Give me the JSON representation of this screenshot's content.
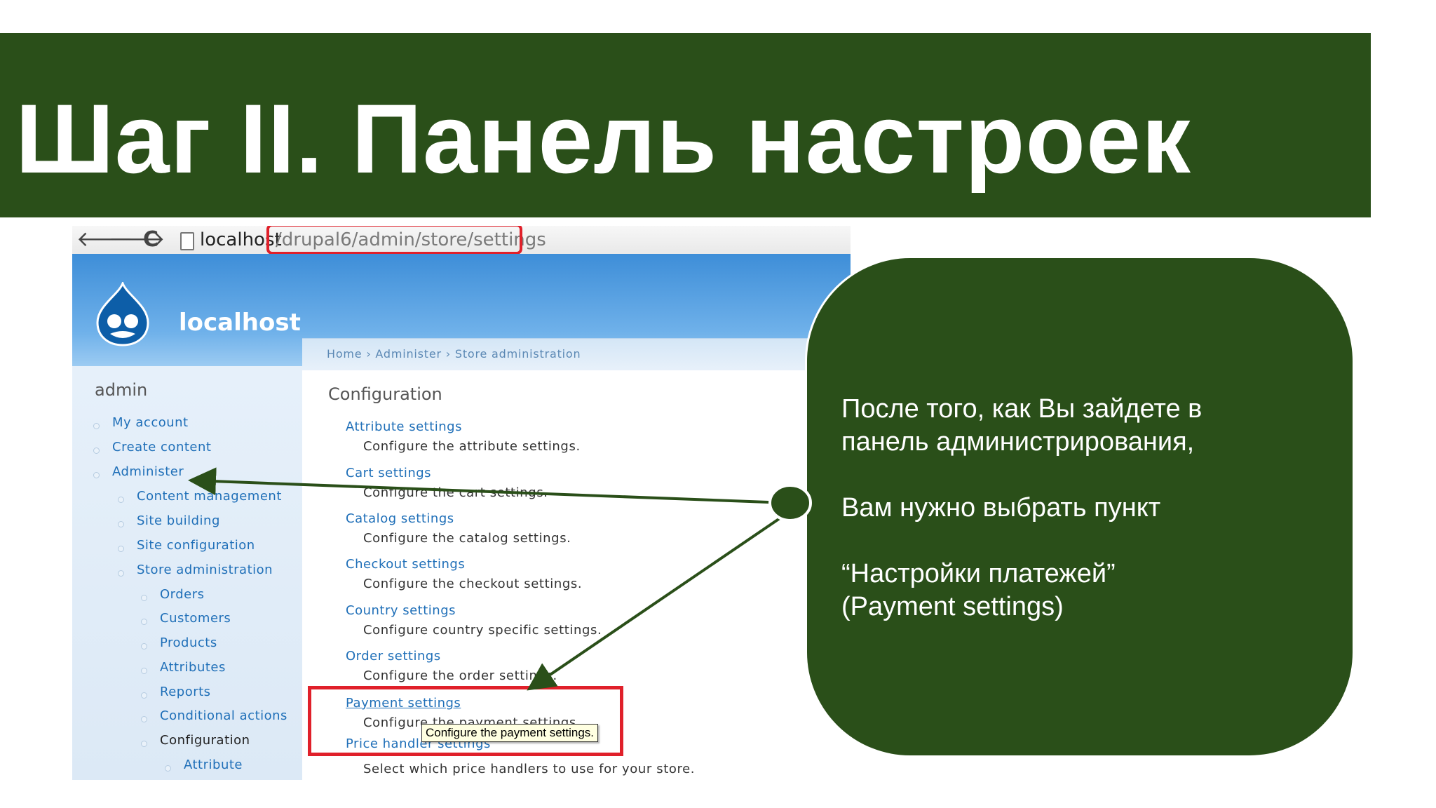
{
  "slide": {
    "title": "Шаг II. Панель настроек"
  },
  "browser": {
    "address_host": "localhost",
    "address_path": "/drupal6/admin/store/settings",
    "nav": {
      "back": "🡐",
      "forward": "🡒",
      "reload": "C"
    }
  },
  "site": {
    "name": "localhost"
  },
  "breadcrumb": {
    "text": "Home › Administer › Store administration"
  },
  "sidebar": {
    "title": "admin",
    "items": [
      {
        "label": "My account",
        "level": 0
      },
      {
        "label": "Create content",
        "level": 0
      },
      {
        "label": "Administer",
        "level": 0
      },
      {
        "label": "Content management",
        "level": 1
      },
      {
        "label": "Site building",
        "level": 1
      },
      {
        "label": "Site configuration",
        "level": 1
      },
      {
        "label": "Store administration",
        "level": 1
      },
      {
        "label": "Orders",
        "level": 2
      },
      {
        "label": "Customers",
        "level": 2
      },
      {
        "label": "Products",
        "level": 2
      },
      {
        "label": "Attributes",
        "level": 2
      },
      {
        "label": "Reports",
        "level": 2
      },
      {
        "label": "Conditional actions",
        "level": 2
      },
      {
        "label": "Configuration",
        "level": 2,
        "active": true
      },
      {
        "label": "Attribute",
        "level": 3
      }
    ]
  },
  "content": {
    "title": "Configuration",
    "settings": [
      {
        "link": "Attribute settings",
        "desc": "Configure the attribute settings."
      },
      {
        "link": "Cart settings",
        "desc": "Configure the cart settings."
      },
      {
        "link": "Catalog settings",
        "desc": "Configure the catalog settings."
      },
      {
        "link": "Checkout settings",
        "desc": "Configure the checkout settings."
      },
      {
        "link": "Country settings",
        "desc": "Configure country specific settings."
      },
      {
        "link": "Order settings",
        "desc": "Configure the order settings."
      },
      {
        "link": "Payment settings",
        "desc": "Configure the payment settings."
      },
      {
        "link": "Price handler settings",
        "desc": "Select which price handlers to use for your store."
      }
    ],
    "tooltip": "Configure the payment settings."
  },
  "callout": {
    "line1": "После того, как Вы зайдете в",
    "line2": "панель администрирования,",
    "line3": "Вам нужно выбрать пункт",
    "line4": "“Настройки платежей”",
    "line5": "(Payment settings)"
  },
  "colors": {
    "slide_green": "#2a4f19",
    "highlight_red": "#e0202a",
    "drupal_link": "#1f6fb8",
    "header_blue": "#3e8ed8"
  }
}
